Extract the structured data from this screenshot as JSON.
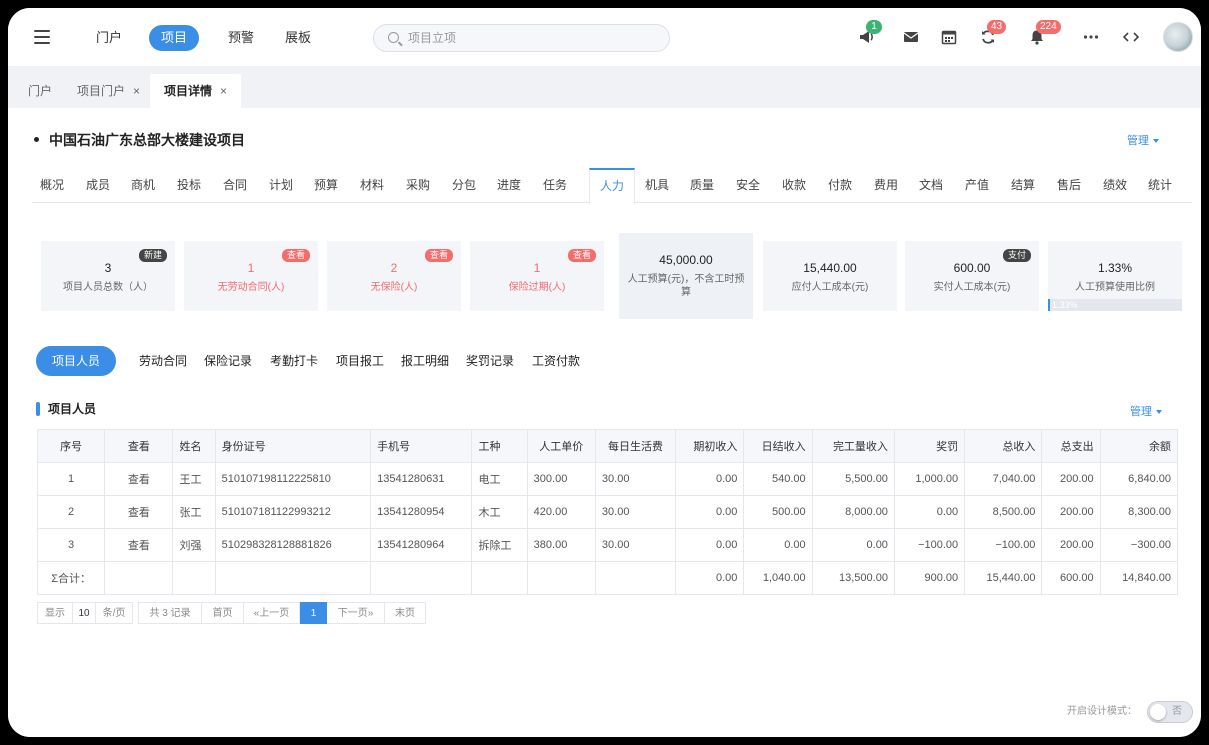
{
  "topnav": {
    "items": [
      "门户",
      "项目",
      "预警",
      "展板"
    ],
    "active_index": 1,
    "search_placeholder": "项目立项",
    "badges": {
      "notice": "1",
      "sync": "43",
      "bell": "224"
    }
  },
  "tabs": [
    {
      "label": "门户",
      "closable": false
    },
    {
      "label": "项目门户",
      "closable": true
    },
    {
      "label": "项目详情",
      "closable": true
    }
  ],
  "close_glyph": "×",
  "project": {
    "title": "中国石油广东总部大楼建设项目",
    "manage_label": "管理"
  },
  "subtabs": [
    "概况",
    "成员",
    "商机",
    "投标",
    "合同",
    "计划",
    "预算",
    "材料",
    "采购",
    "分包",
    "进度",
    "任务",
    "人力",
    "机具",
    "质量",
    "安全",
    "收款",
    "付款",
    "费用",
    "文档",
    "产值",
    "结算",
    "售后",
    "绩效",
    "统计"
  ],
  "cards": [
    {
      "value": "3",
      "label": "项目人员总数（人）",
      "badge": "新建"
    },
    {
      "value": "1",
      "label": "无劳动合同(人)",
      "badge": "查看"
    },
    {
      "value": "2",
      "label": "无保险(人)",
      "badge": "查看"
    },
    {
      "value": "1",
      "label": "保险过期(人)",
      "badge": "查看"
    },
    {
      "value": "45,000.00",
      "label": "人工预算(元)，不含工时预算",
      "badge": ""
    },
    {
      "value": "15,440.00",
      "label": "应付人工成本(元)",
      "badge": ""
    },
    {
      "value": "600.00",
      "label": "实付人工成本(元)",
      "badge": "支付"
    },
    {
      "value": "1.33%",
      "label": "人工预算使用比例",
      "badge": "",
      "progress_text": "1.33%",
      "progress": 0.0133
    }
  ],
  "pills": [
    "项目人员",
    "劳动合同",
    "保险记录",
    "考勤打卡",
    "项目报工",
    "报工明细",
    "奖罚记录",
    "工资付款"
  ],
  "section": {
    "title": "项目人员",
    "manage_label": "管理"
  },
  "table": {
    "headers": [
      "序号",
      "查看",
      "姓名",
      "身份证号",
      "手机号",
      "工种",
      "人工单价",
      "每日生活费",
      "期初收入",
      "日结收入",
      "完工量收入",
      "奖罚",
      "总收入",
      "总支出",
      "余额"
    ],
    "rows": [
      [
        "1",
        "查看",
        "王工",
        "510107198112225810",
        "13541280631",
        "电工",
        "300.00",
        "30.00",
        "0.00",
        "540.00",
        "5,500.00",
        "1,000.00",
        "7,040.00",
        "200.00",
        "6,840.00"
      ],
      [
        "2",
        "查看",
        "张工",
        "510107181122993212",
        "13541280954",
        "木工",
        "420.00",
        "30.00",
        "0.00",
        "500.00",
        "8,000.00",
        "0.00",
        "8,500.00",
        "200.00",
        "8,300.00"
      ],
      [
        "3",
        "查看",
        "刘强",
        "510298328128881826",
        "13541280964",
        "拆除工",
        "380.00",
        "30.00",
        "0.00",
        "0.00",
        "0.00",
        "−100.00",
        "−100.00",
        "200.00",
        "−300.00"
      ]
    ],
    "total": [
      "Σ合计：",
      "",
      "",
      "",
      "",
      "",
      "",
      "",
      "0.00",
      "1,040.00",
      "13,500.00",
      "900.00",
      "15,440.00",
      "600.00",
      "14,840.00"
    ]
  },
  "pager": {
    "show_label": "显示",
    "page_size": "10",
    "per_page_label": "条/页",
    "total_label": "共 3 记录",
    "first": "首页",
    "prev": "«上一页",
    "current": "1",
    "next": "下一页»",
    "last": "末页"
  },
  "design_mode": {
    "label": "开启设计模式：",
    "state": "否"
  }
}
